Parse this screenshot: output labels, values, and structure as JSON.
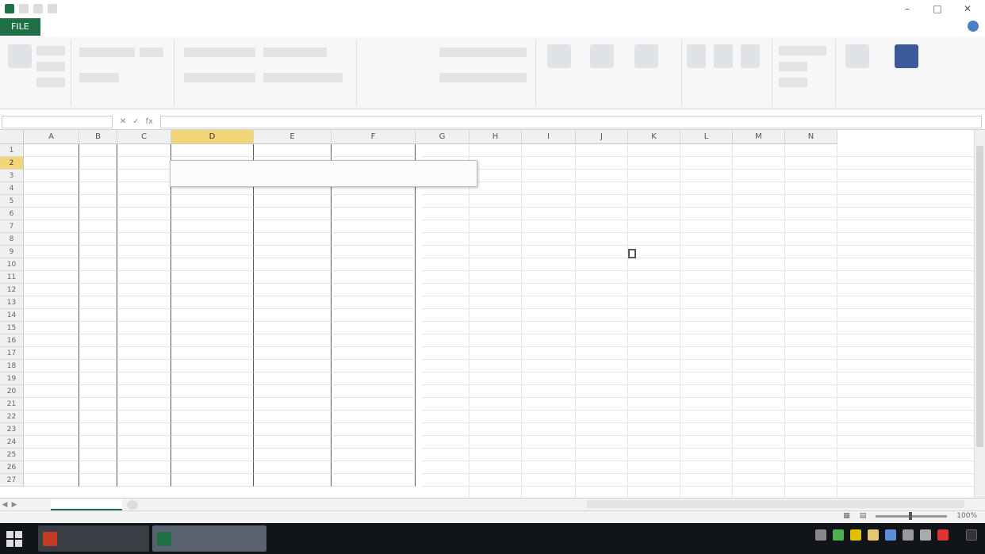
{
  "window": {
    "title": "",
    "controls": [
      "–",
      "□",
      "✕"
    ]
  },
  "ribbon_tabs": [
    "FILE",
    "",
    "",
    "",
    "",
    "",
    "",
    "",
    "",
    ""
  ],
  "ribbon": {
    "groups": [
      "",
      "",
      "",
      "",
      "",
      "",
      "",
      ""
    ]
  },
  "formula_bar": {
    "name_box": "",
    "formula": ""
  },
  "grid": {
    "columns": [
      "A",
      "B",
      "C",
      "D",
      "E",
      "F",
      "G",
      "H",
      "I",
      "J",
      "K",
      "L",
      "M",
      "N"
    ],
    "selected_column": "D",
    "selected_row": 2,
    "rows": [
      1,
      2,
      3,
      4,
      5,
      6,
      7,
      8,
      9,
      10,
      11,
      12,
      13,
      14,
      15,
      16,
      17,
      18,
      19,
      20,
      21,
      22,
      23,
      24,
      25,
      26,
      27
    ]
  },
  "tooltip": {
    "line1": "",
    "line2": ""
  },
  "annotation": {
    "text": "",
    "color": "#d21f1f"
  },
  "sheet_tabs": {
    "tabs": [
      "",
      ""
    ],
    "active_index": 1
  },
  "status": {
    "left": "",
    "zoom": "100%"
  },
  "taskbar": {
    "items": [
      "",
      ""
    ],
    "clock_time": "",
    "clock_date": ""
  },
  "colors": {
    "accent": "#1e7145",
    "selection": "#f3d57a"
  }
}
